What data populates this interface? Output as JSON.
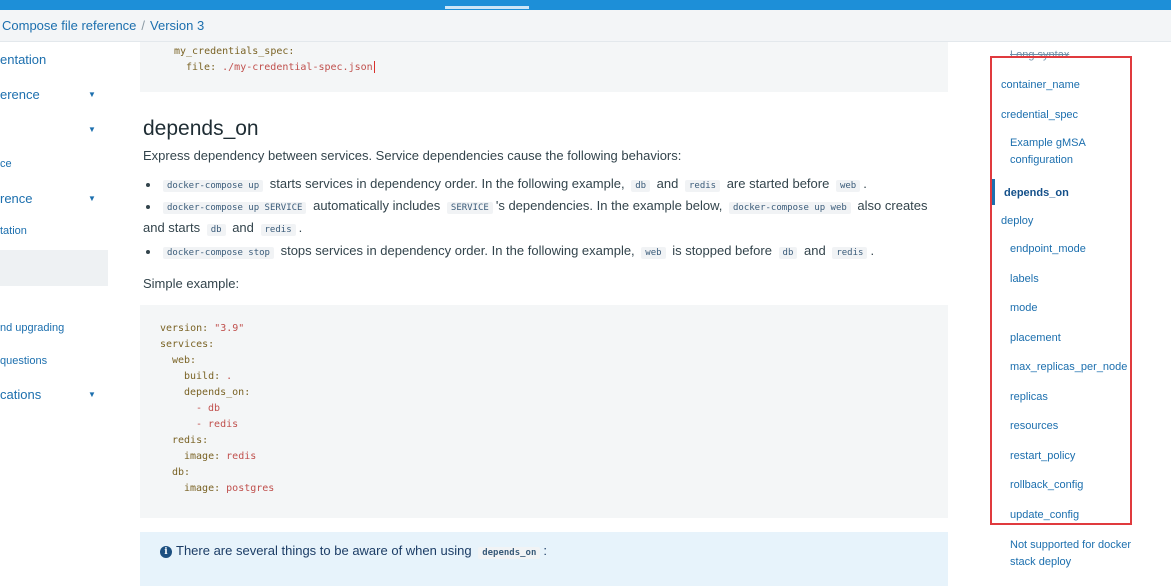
{
  "breadcrumb": {
    "parent": "Compose file reference",
    "separator": "/",
    "current": "Version 3"
  },
  "left_nav": {
    "items": [
      {
        "label": "entation",
        "chevron": false
      },
      {
        "label": "erence",
        "chevron": true
      },
      {
        "label": "",
        "chevron": true
      },
      {
        "label": "ce",
        "chevron": false
      },
      {
        "label": "rence",
        "chevron": true
      },
      {
        "label": "tation",
        "chevron": false
      },
      {
        "label": "nd upgrading",
        "chevron": false
      },
      {
        "label": " questions",
        "chevron": false
      },
      {
        "label": "cations",
        "chevron": true
      }
    ]
  },
  "main": {
    "top_code": {
      "line1": "my_credentials_spec:",
      "line2_key": "file:",
      "line2_value": "./my-credential-spec.json"
    },
    "heading": "depends_on",
    "intro": "Express dependency between services. Service dependencies cause the following behaviors:",
    "bullets": [
      {
        "code1": "docker-compose up",
        "t1": "starts services in dependency order. In the following example,",
        "code2": "db",
        "t2": "and",
        "code3": "redis",
        "t3": "are started before",
        "code4": "web",
        "t4": "."
      },
      {
        "code1": "docker-compose up SERVICE",
        "t1": "automatically includes",
        "code2": "SERVICE",
        "t2": "'s dependencies. In the example below,",
        "code3": "docker-compose up web",
        "t3": "also creates",
        "line2_t": "and starts",
        "line2_code1": "db",
        "line2_and": "and",
        "line2_code2": "redis",
        "line2_end": "."
      },
      {
        "code1": "docker-compose stop",
        "t1": "stops services in dependency order. In the following example,",
        "code2": "web",
        "t2": "is stopped before",
        "code3": "db",
        "t3": "and",
        "code4": "redis",
        "t4": "."
      }
    ],
    "simple_example": "Simple example:",
    "yaml": {
      "version_key": "version:",
      "version_val": "\"3.9\"",
      "services": "services:",
      "web": "web:",
      "build_key": "build:",
      "build_val": ".",
      "depends_on": "depends_on:",
      "dep1": "- db",
      "dep2": "- redis",
      "redis": "redis:",
      "redis_image_key": "image:",
      "redis_image_val": "redis",
      "db": "db:",
      "db_image_key": "image:",
      "db_image_val": "postgres"
    },
    "note": {
      "text": "There are several things to be aware of when using",
      "code": "depends_on",
      "end": ":"
    }
  },
  "toc": {
    "long_syntax": "Long syntax",
    "container_name": "container_name",
    "credential_spec": "credential_spec",
    "example_gmsa_1": "Example gMSA",
    "example_gmsa_2": "configuration",
    "depends_on": "depends_on",
    "deploy": "deploy",
    "endpoint_mode": "endpoint_mode",
    "labels": "labels",
    "mode": "mode",
    "placement": "placement",
    "max_replicas_per_node": "max_replicas_per_node",
    "replicas": "replicas",
    "resources": "resources",
    "restart_policy": "restart_policy",
    "rollback_config": "rollback_config",
    "update_config": "update_config",
    "not_supported_1": "Not supported for docker",
    "not_supported_2": "stack deploy"
  },
  "colors": {
    "accent": "#1d8fd8",
    "link": "#1c6fae",
    "highlight_box": "#e03a3e"
  }
}
